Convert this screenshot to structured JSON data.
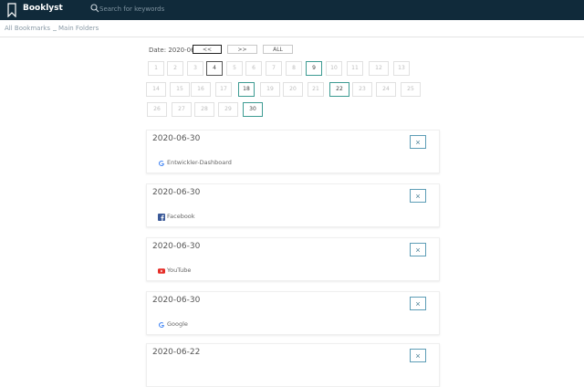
{
  "header": {
    "title": "Booklyst",
    "search_placeholder": "Search for keywords",
    "icons": [
      "bookmark-icon",
      "search-icon"
    ]
  },
  "subnav": {
    "bookmarks_link": "All Bookmarks",
    "folders_link": "Main Folders"
  },
  "date_filter": {
    "label": "Date: 2020-06",
    "prev_label": "<<",
    "next_label": ">>",
    "all_label": "ALL"
  },
  "calendar": {
    "days": [
      "1",
      "2",
      "3",
      "4",
      "5",
      "6",
      "7",
      "8",
      "9",
      "10",
      "11",
      "12",
      "13",
      "14",
      "15",
      "16",
      "17",
      "18",
      "19",
      "20",
      "21",
      "22",
      "23",
      "24",
      "25",
      "26",
      "27",
      "28",
      "29",
      "30"
    ],
    "highlighted_days": [
      "4",
      "9",
      "18",
      "22",
      "30"
    ]
  },
  "bookmarks": [
    {
      "date": "2020-06-30",
      "title": "Entwickler-Dashboard",
      "favicon": "google-icon"
    },
    {
      "date": "2020-06-30",
      "title": "Facebook",
      "favicon": "facebook-icon"
    },
    {
      "date": "2020-06-30",
      "title": "YouTube",
      "favicon": "youtube-icon"
    },
    {
      "date": "2020-06-30",
      "title": "Google",
      "favicon": "google-icon"
    },
    {
      "date": "2020-06-22",
      "title": "",
      "favicon": ""
    }
  ],
  "close_label": "×",
  "colors": {
    "topbar": "#102a3a",
    "accent": "#3d9b92",
    "close_border": "#5d9db6"
  }
}
